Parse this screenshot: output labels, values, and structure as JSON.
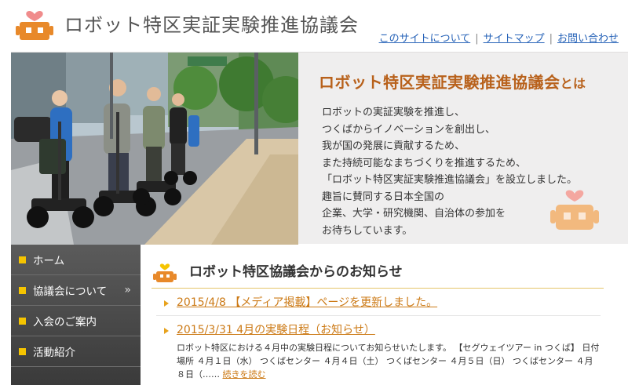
{
  "header": {
    "site_title": "ロボット特区実証実験推進協議会",
    "util_links": [
      "このサイトについて",
      "サイトマップ",
      "お問い合わせ"
    ]
  },
  "hero": {
    "title": "ロボット特区実証実験推進協議会",
    "title_suffix": "とは",
    "body_lines": [
      "ロボットの実証実験を推進し、",
      "つくばからイノベーションを創出し、",
      "我が国の発展に貢献するため、",
      "また持続可能なまちづくりを推進するため、",
      "「ロボット特区実証実験推進協議会」を設立しました。",
      "趣旨に賛同する日本全国の",
      "企業、大学・研究機関、自治体の参加を",
      "お待ちしています。"
    ]
  },
  "sidebar": {
    "items": [
      {
        "label": "ホーム",
        "icon": "square-bullet-icon"
      },
      {
        "label": "協議会について",
        "icon": "square-bullet-icon",
        "chevron": "»"
      },
      {
        "label": "入会のご案内",
        "icon": "square-bullet-icon"
      },
      {
        "label": "活動紹介",
        "icon": "square-bullet-icon"
      }
    ]
  },
  "news": {
    "heading": "ロボット特区協議会からのお知らせ",
    "items": [
      {
        "title": "2015/4/8 【メディア掲載】ページを更新しました。"
      },
      {
        "title": "2015/3/31 4月の実験日程（お知らせ）",
        "excerpt": "ロボット特区における４月中の実験日程についてお知らせいたします。 【セグウェイツアー in つくば】 日付 場所 ４月１日（水） つくばセンター ４月４日（土） つくばセンター ４月５日（日） つくばセンター ４月８日（……",
        "more": "続きを読む"
      }
    ]
  },
  "colors": {
    "accent_orange": "#e8892a",
    "title_brown": "#b8611b",
    "link_blue": "#2763b8",
    "news_link": "#cc7a16",
    "bullet_yellow": "#f5c400",
    "heart_pink": "#f08c8c"
  }
}
